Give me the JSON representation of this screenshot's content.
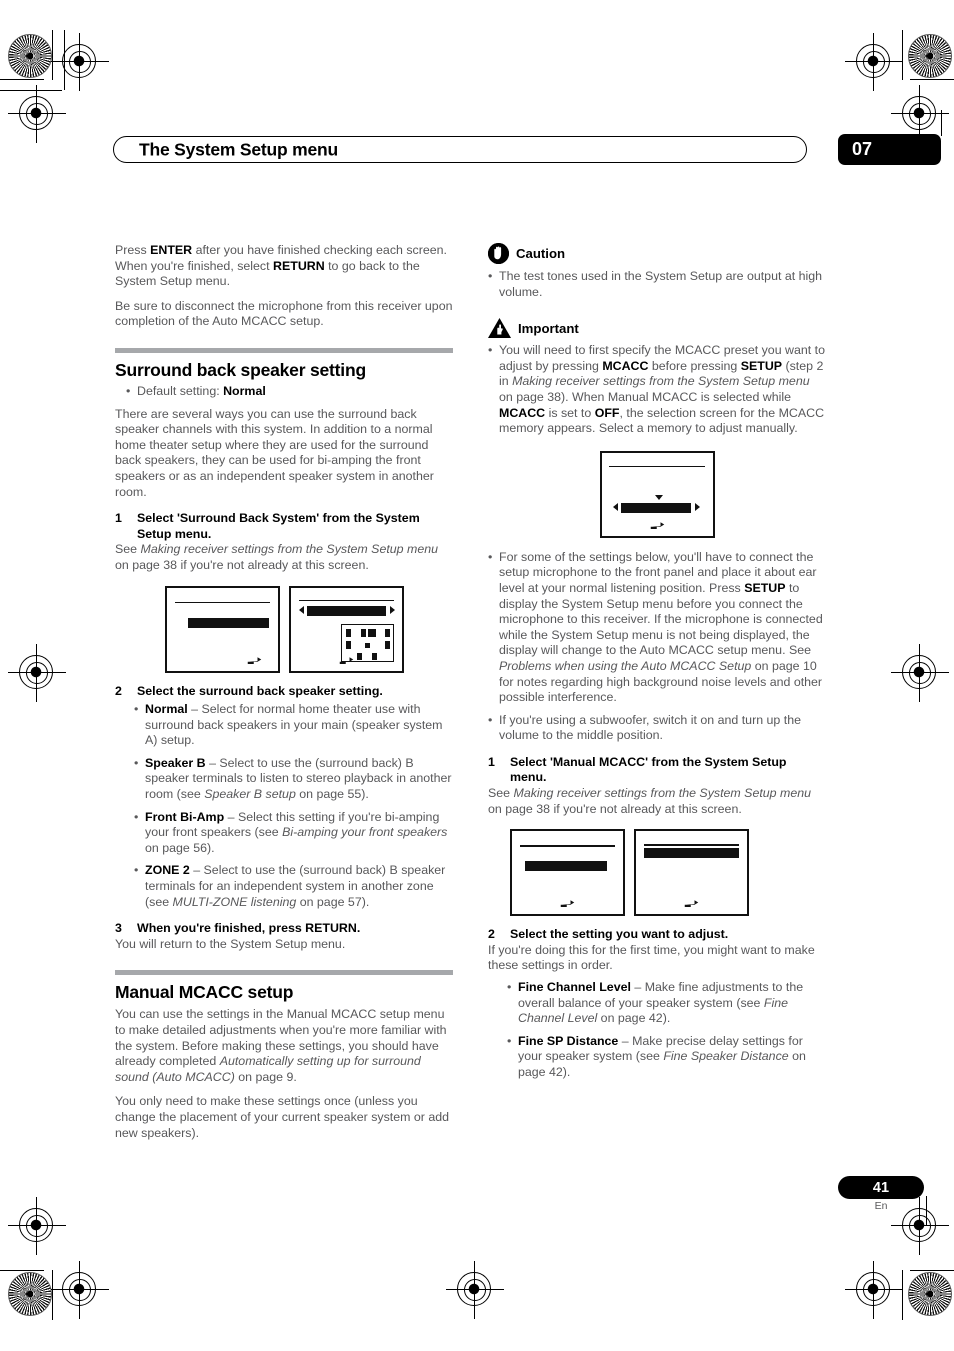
{
  "header": {
    "title": "The System Setup menu",
    "chapter": "07"
  },
  "footer": {
    "page_number": "41",
    "language": "En"
  },
  "left_column": {
    "intro_para_1": {
      "a": "Press ",
      "b1": "ENTER",
      "c": " after you have finished checking each screen. When you're finished, select ",
      "b2": "RETURN",
      "d": " to go back to the System Setup menu."
    },
    "intro_para_2": "Be sure to disconnect the microphone from this receiver upon completion of the Auto MCACC setup.",
    "section_title": "Surround back speaker setting",
    "default_setting": {
      "label": "Default setting: ",
      "value": "Normal"
    },
    "section_body": "There are several ways you can use the surround back speaker channels with this system. In addition to a normal home theater setup where they are used for the surround back speakers, they can be used for bi-amping the front speakers or as an independent speaker system in another room.",
    "step1": {
      "num": "1",
      "title": "Select 'Surround Back System' from the System Setup menu.",
      "body_a": "See ",
      "body_i": "Making receiver settings from the System Setup menu",
      "body_b": " on page 38 if you're not already at this screen."
    },
    "step2": {
      "num": "2",
      "title": "Select the surround back speaker setting."
    },
    "step2_bullets": [
      {
        "term": "Normal",
        "dash": " – ",
        "text_a": "Select for normal home theater use with surround back speakers in your main (speaker system A) setup.",
        "italic": "",
        "text_b": ""
      },
      {
        "term": "Speaker B",
        "dash": " – ",
        "text_a": "Select to use the (surround back) B speaker terminals to listen to stereo playback in another room (see ",
        "italic": "Speaker B setup",
        "text_b": " on page 55)."
      },
      {
        "term": "Front Bi-Amp",
        "dash": " – ",
        "text_a": "Select this setting if you're bi-amping your front speakers (see ",
        "italic": "Bi-amping your front speakers",
        "text_b": " on page 56)."
      },
      {
        "term": "ZONE 2",
        "dash": " – ",
        "text_a": "Select to use the (surround back) B speaker terminals for an independent system in another zone (see ",
        "italic": "MULTI-ZONE listening",
        "text_b": " on page 57)."
      }
    ],
    "step3": {
      "num": "3",
      "title": "When you're finished, press RETURN.",
      "body": "You will return to the System Setup menu."
    },
    "section2_title": "Manual MCACC setup",
    "section2_body_1": {
      "a": "You can use the settings in the Manual MCACC setup menu to make detailed adjustments when you're more familiar with the system. Before making these settings, you should have already completed ",
      "i": "Automatically setting up for surround sound (Auto MCACC)",
      "b": " on page 9."
    },
    "section2_body_2": "You only need to make these settings once (unless you change the placement of your current speaker system or add new speakers)."
  },
  "right_column": {
    "caution": {
      "icon": "hand-stop-icon",
      "label": "Caution",
      "bullet": "The test tones used in the System Setup are output at high volume."
    },
    "important": {
      "icon": "warning-triangle-pointing-hand-icon",
      "label": "Important",
      "bullet_1": {
        "a": "You will need to first specify the MCACC preset you want to adjust by pressing ",
        "b1": "MCACC",
        "c": " before pressing ",
        "b2": "SETUP",
        "d": " (step 2 in ",
        "i": "Making receiver settings from the System Setup menu",
        "e": " on page 38). When Manual MCACC is selected while ",
        "b3": "MCACC",
        "f": " is set to ",
        "b4": "OFF",
        "g": ", the selection screen for the MCACC memory appears. Select a memory to adjust manually."
      },
      "bullet_2": {
        "a": "For some of the settings below, you'll have to connect the setup microphone to the front panel and place it about ear level at your normal listening position. Press ",
        "b1": "SETUP",
        "c": " to display the System Setup menu before you connect the microphone to this receiver. If the microphone is connected while the System Setup menu is not being displayed, the display will change to the Auto MCACC setup menu. See ",
        "i": "Problems when using the Auto MCACC Setup",
        "d": " on page 10 for notes regarding high background noise levels and other possible interference."
      },
      "bullet_3": "If you're using a subwoofer, switch it on and turn up the volume to the middle position."
    },
    "step1": {
      "num": "1",
      "title": "Select 'Manual MCACC' from the System Setup menu.",
      "body_a": "See ",
      "body_i": "Making receiver settings from the System Setup menu",
      "body_b": " on page 38 if you're not already at this screen."
    },
    "step2": {
      "num": "2",
      "title": "Select the setting you want to adjust.",
      "body": "If you're doing this for the first time, you might want to make these settings in order."
    },
    "step2_bullets": [
      {
        "term": "Fine Channel Level",
        "dash": " – ",
        "text_a": "Make fine adjustments to the overall balance of your speaker system (see ",
        "italic": "Fine Channel Level",
        "text_b": " on page 42)."
      },
      {
        "term": "Fine SP Distance",
        "dash": " – ",
        "text_a": "Make precise delay settings for your speaker system (see ",
        "italic": "Fine Speaker Distance",
        "text_b": " on page 42)."
      }
    ]
  },
  "colors": {
    "body_text": "#58585a",
    "heading": "#000000",
    "rule": "#a6a8ab",
    "badge_bg": "#000000"
  }
}
